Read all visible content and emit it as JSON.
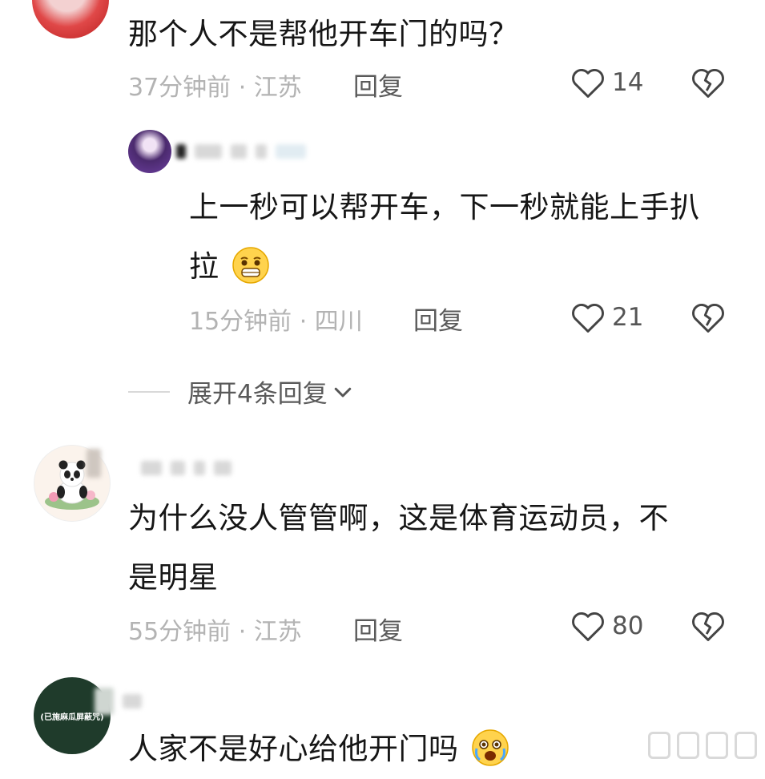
{
  "comments": [
    {
      "text": "那个人不是帮他开车门的吗？",
      "time_location": "37分钟前 · 江苏",
      "reply_label": "回复",
      "likes": "14"
    },
    {
      "text_line1": "上一秒可以帮开车，下一秒就能上手扒",
      "text_line2": "拉",
      "time_location": "15分钟前 · 四川",
      "reply_label": "回复",
      "likes": "21"
    },
    {
      "text_line1": "为什么没人管管啊，这是体育运动员，不",
      "text_line2": "是明星",
      "time_location": "55分钟前 · 江苏",
      "reply_label": "回复",
      "likes": "80"
    },
    {
      "text": "人家不是好心给他开门吗",
      "avatar_text": "(已施麻瓜屏蔽咒)"
    }
  ],
  "expand_replies": "展开4条回复",
  "icons": {
    "like": "heart-outline-icon",
    "dislike": "broken-heart-icon",
    "expand": "chevron-down-icon",
    "emoji_grimace": "grimace-emoji-icon",
    "emoji_crying": "crying-emoji-icon"
  },
  "colors": {
    "text": "#161616",
    "meta": "#b3b3b3",
    "action": "#5a5a5a",
    "avatar_green": "#1f3b2b"
  }
}
